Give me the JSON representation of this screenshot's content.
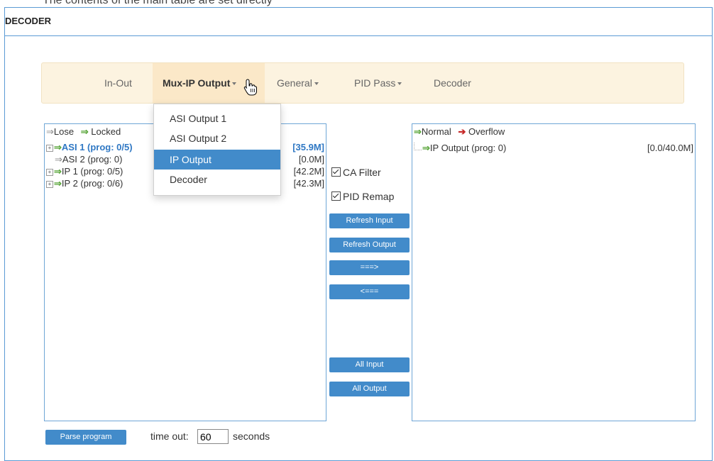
{
  "header": {
    "title": "DECODER",
    "cutoff_text": "The contents of the main table are set directly"
  },
  "nav": {
    "items": [
      {
        "label": "In-Out",
        "dropdown": false
      },
      {
        "label": "Mux-IP Output",
        "dropdown": true,
        "active": true
      },
      {
        "label": "General",
        "dropdown": true
      },
      {
        "label": "PID Pass",
        "dropdown": true
      },
      {
        "label": "Decoder",
        "dropdown": false
      }
    ]
  },
  "dropdown": {
    "items": [
      "ASI Output 1",
      "ASI Output 2",
      "IP Output",
      "Decoder"
    ],
    "selected": "IP Output"
  },
  "input_panel": {
    "legend": {
      "lose": "Lose",
      "locked": "Locked"
    },
    "rows": [
      {
        "label": "ASI 1 (prog: 0/5)",
        "bitrate": "[35.9M]",
        "expandable": true,
        "highlight": true
      },
      {
        "label": "ASI 2 (prog: 0)",
        "bitrate": "[0.0M]",
        "expandable": false,
        "highlight": false
      },
      {
        "label": "IP 1 (prog: 0/5)",
        "bitrate": "[42.2M]",
        "expandable": true,
        "highlight": false
      },
      {
        "label": "IP 2 (prog: 0/6)",
        "bitrate": "[42.3M]",
        "expandable": true,
        "highlight": false
      }
    ]
  },
  "options": {
    "ca_filter": "CA Filter",
    "pid_remap": "PID Remap"
  },
  "buttons": {
    "refresh_input": "Refresh Input",
    "refresh_output": "Refresh Output",
    "add": "===>",
    "remove": "<===",
    "all_input": "All Input",
    "all_output": "All Output"
  },
  "output_panel": {
    "legend": {
      "normal": "Normal",
      "overflow": "Overflow"
    },
    "rows": [
      {
        "label": "IP Output (prog: 0)",
        "bitrate": "[0.0/40.0M]"
      }
    ]
  },
  "footer": {
    "parse_button": "Parse program",
    "timeout_label": "time out:",
    "timeout_value": "60",
    "seconds_label": "seconds"
  },
  "colors": {
    "accent": "#428bca",
    "nav_bg": "#fcf3e0",
    "green_arrow": "#5aa63b",
    "red_arrow": "#c62828",
    "border": "#5b9bd5"
  }
}
